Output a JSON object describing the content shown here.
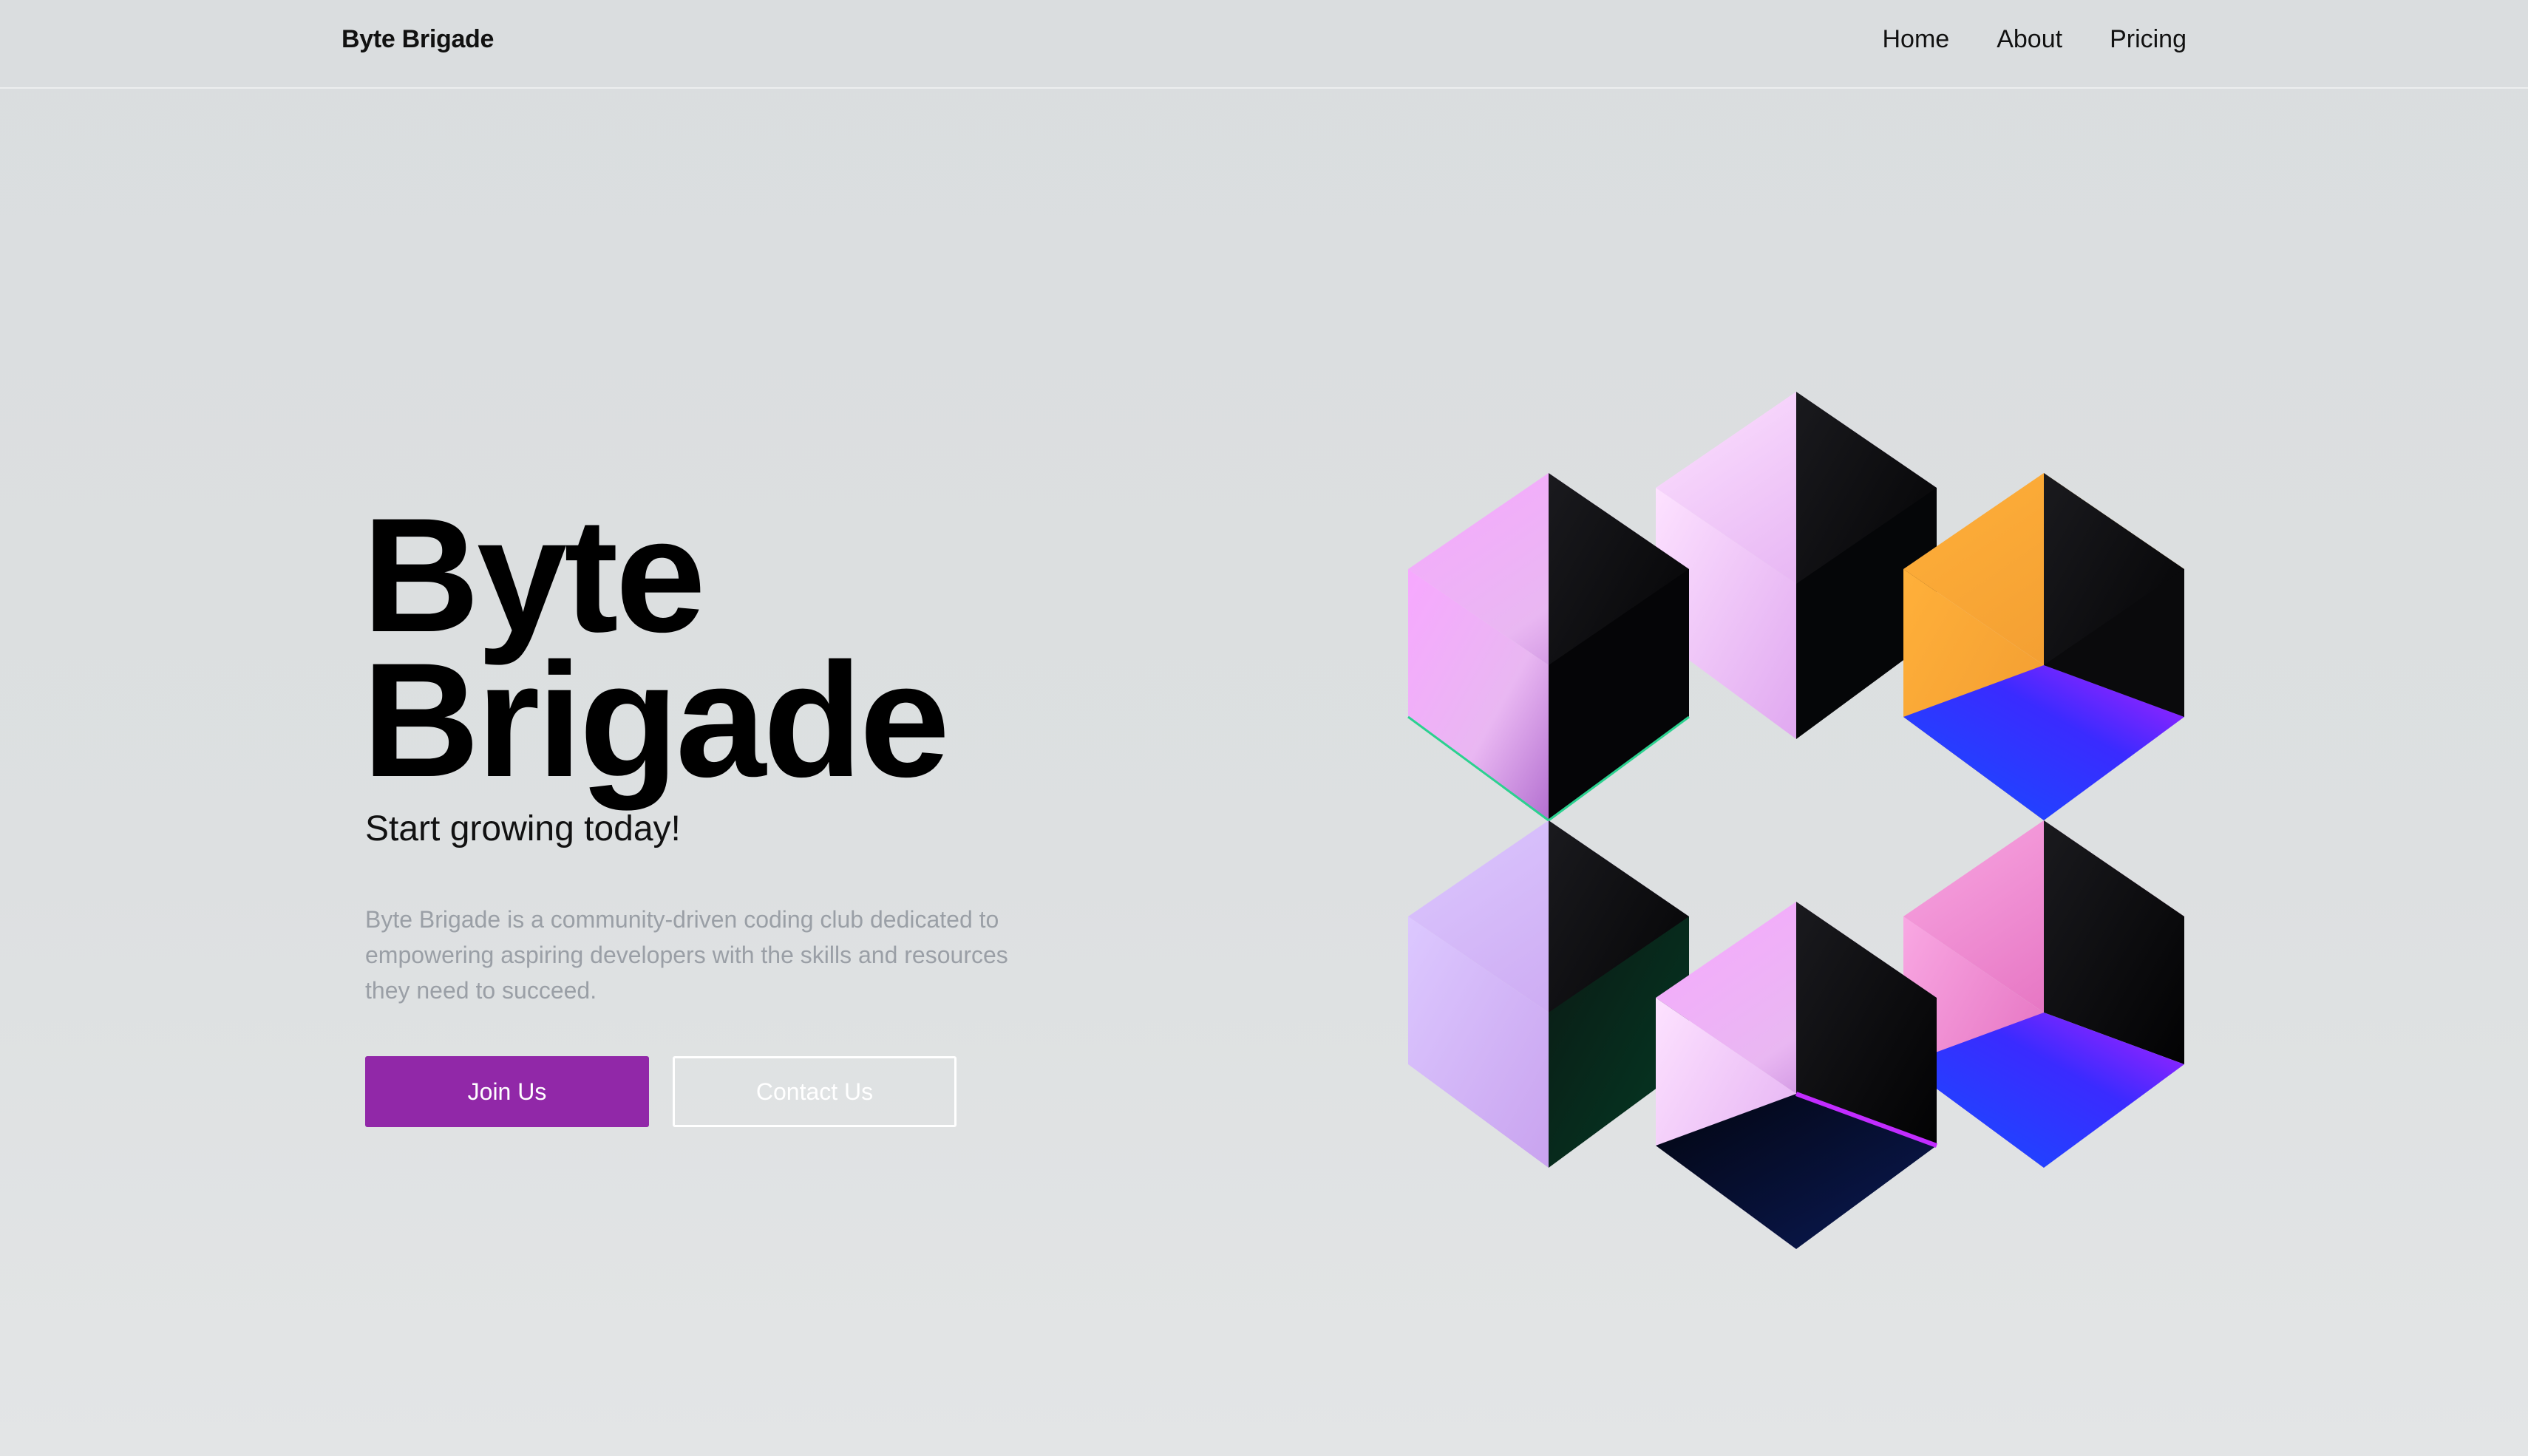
{
  "navbar": {
    "brand": "Byte Brigade",
    "links": [
      "Home",
      "About",
      "Pricing"
    ]
  },
  "hero": {
    "title_line1": "Byte",
    "title_line2": "Brigade",
    "tagline": "Start growing today!",
    "description": "Byte Brigade is a community-driven coding club dedicated to empowering aspiring developers with the skills and resources they need to succeed.",
    "primary_button": "Join Us",
    "secondary_button": "Contact Us"
  },
  "colors": {
    "accent": "#9128a8",
    "background": "#dadddf",
    "text": "#000000",
    "muted": "#9a9fa6"
  },
  "illustration": {
    "icon": "iridescent-cubes-graphic"
  }
}
